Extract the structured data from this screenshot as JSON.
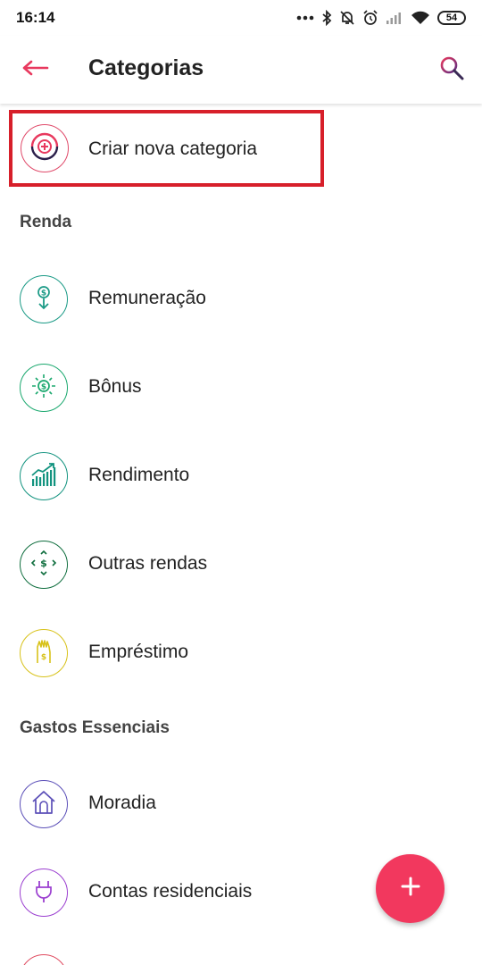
{
  "status_bar": {
    "time": "16:14",
    "battery": "54"
  },
  "app_bar": {
    "title": "Categorias"
  },
  "create": {
    "label": "Criar nova categoria"
  },
  "sections": {
    "renda": {
      "title": "Renda"
    },
    "gastos": {
      "title": "Gastos Essenciais"
    }
  },
  "items": {
    "remuneracao": {
      "label": "Remuneração",
      "icon": "salary-icon",
      "color": "#1a9a86"
    },
    "bonus": {
      "label": "Bônus",
      "icon": "bonus-icon",
      "color": "#1aa86e"
    },
    "rendimento": {
      "label": "Rendimento",
      "icon": "growth-chart-icon",
      "color": "#12937f"
    },
    "outras": {
      "label": "Outras rendas",
      "icon": "other-income-icon",
      "color": "#0f6e3e"
    },
    "emprestimo": {
      "label": "Empréstimo",
      "icon": "loan-hand-icon",
      "color": "#d8c21a"
    },
    "moradia": {
      "label": "Moradia",
      "icon": "house-icon",
      "color": "#5b4fb8"
    },
    "contas": {
      "label": "Contas residenciais",
      "icon": "plug-icon",
      "color": "#9b3fd0"
    }
  },
  "colors": {
    "accent": "#f2385e",
    "highlight": "#d71f2a"
  }
}
